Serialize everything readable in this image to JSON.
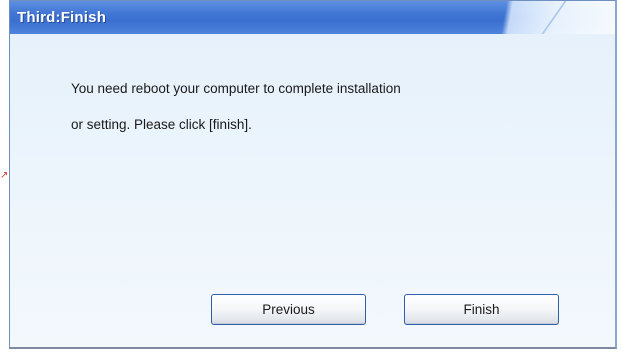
{
  "window": {
    "title": "Third:Finish"
  },
  "message": {
    "line1": "You need reboot your computer to complete installation",
    "line2": "or setting. Please click [finish]."
  },
  "buttons": {
    "previous_label": "Previous",
    "finish_label": "Finish"
  },
  "colors": {
    "titlebar": "#3f75d4",
    "body_background": "#eef5fb",
    "button_border": "#2d5fa8"
  }
}
